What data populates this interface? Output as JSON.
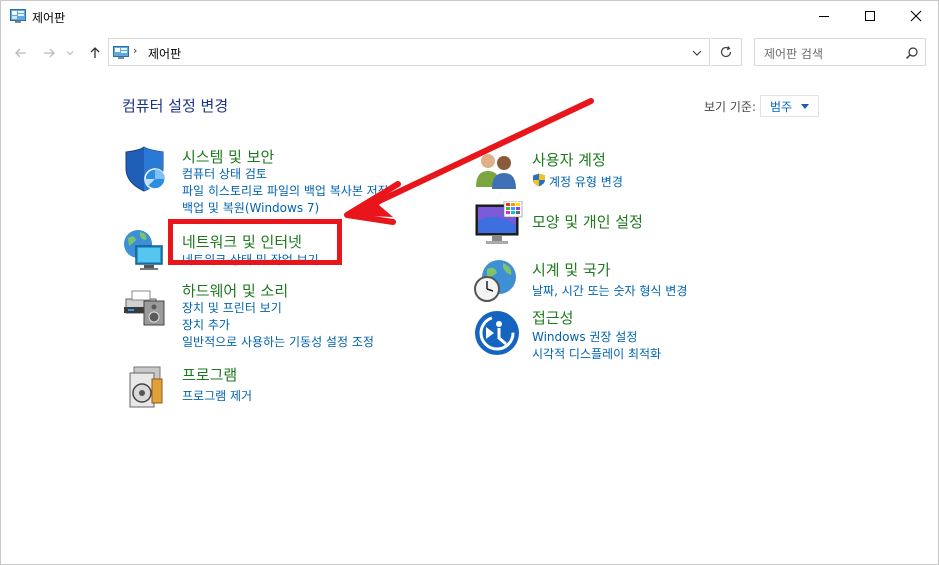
{
  "window": {
    "title": "제어판"
  },
  "address": {
    "separator": "›",
    "path": "제어판"
  },
  "search": {
    "placeholder": "제어판 검색"
  },
  "main": {
    "heading": "컴퓨터 설정 변경",
    "view_by_label": "보기 기준:",
    "view_by_value": "범주"
  },
  "categories_left": [
    {
      "title": "시스템 및 보안",
      "links": [
        "컴퓨터 상태 검토",
        "파일 히스토리로 파일의 백업 복사본 저장",
        "백업 및 복원(Windows 7)"
      ]
    },
    {
      "title": "네트워크 및 인터넷",
      "links": [
        "네트워크 상태 및 작업 보기"
      ]
    },
    {
      "title": "하드웨어 및 소리",
      "links": [
        "장치 및 프린터 보기",
        "장치 추가",
        "일반적으로 사용하는 기동성 설정 조정"
      ]
    },
    {
      "title": "프로그램",
      "links": [
        "프로그램 제거"
      ]
    }
  ],
  "categories_right": [
    {
      "title": "사용자 계정",
      "links": [
        "계정 유형 변경"
      ]
    },
    {
      "title": "모양 및 개인 설정",
      "links": []
    },
    {
      "title": "시계 및 국가",
      "links": [
        "날짜, 시간 또는 숫자 형식 변경"
      ]
    },
    {
      "title": "접근성",
      "links": [
        "Windows 권장 설정",
        "시각적 디스플레이 최적화"
      ]
    }
  ],
  "colors": {
    "category_title": "#1e7a1e",
    "link": "#0063b1",
    "heading": "#1e3287",
    "annotation": "#e8151b"
  }
}
